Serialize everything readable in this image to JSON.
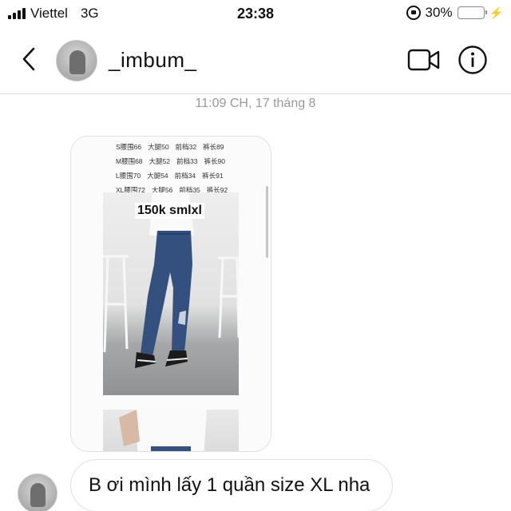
{
  "status_bar": {
    "carrier": "Viettel",
    "network": "3G",
    "time": "23:38",
    "battery_percent": "30%",
    "battery_level": 0.3
  },
  "header": {
    "username": "_imbum_",
    "icons": [
      "back-chevron-icon",
      "video-camera-icon",
      "info-icon"
    ]
  },
  "conversation": {
    "timestamp": "11:09 CH, 17 tháng 8",
    "image_message": {
      "size_table": [
        [
          "S腰围66",
          "大腿50",
          "前档32",
          "裤长89"
        ],
        [
          "M腰围68",
          "大腿52",
          "前档33",
          "裤长90"
        ],
        [
          "L腰围70",
          "大腿54",
          "前档34",
          "裤长91"
        ],
        [
          "XL腰围72",
          "大腿56",
          "前档35",
          "裤长92"
        ]
      ],
      "price_label": "150k smlxl"
    },
    "text_message": "B ơi mình lấy 1 quần size XL nha"
  },
  "colors": {
    "battery_fill": "#4cd964",
    "bubble_border": "#e0e0e0",
    "timestamp_text": "#999999"
  }
}
